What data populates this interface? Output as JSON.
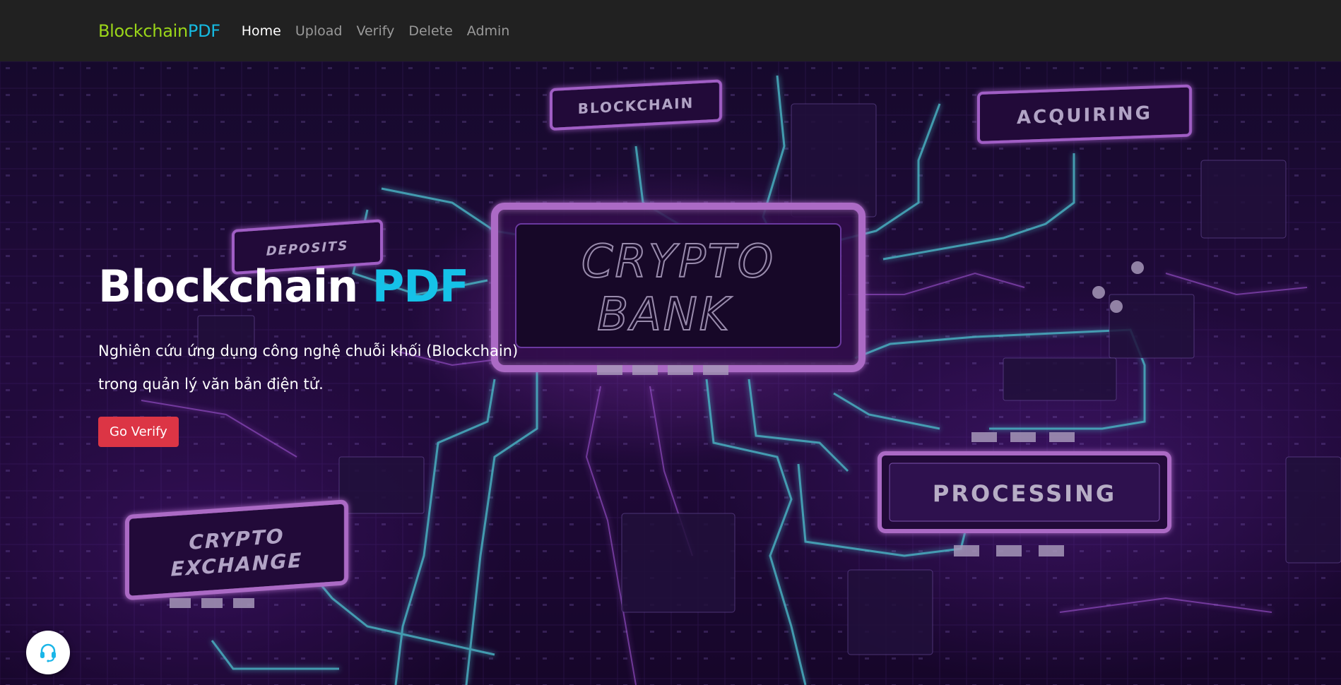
{
  "navbar": {
    "brand_part1": "Blockchain",
    "brand_part2": "PDF",
    "links": [
      {
        "label": "Home",
        "active": true
      },
      {
        "label": "Upload",
        "active": false
      },
      {
        "label": "Verify",
        "active": false
      },
      {
        "label": "Delete",
        "active": false
      },
      {
        "label": "Admin",
        "active": false
      }
    ]
  },
  "hero": {
    "title_part1": "Blockchain ",
    "title_part2": "PDF",
    "description_line1": "Nghiên cứu ứng dụng công nghệ chuỗi khối (Blockchain)",
    "description_line2": "trong quản lý văn bản điện tử.",
    "button_label": "Go Verify",
    "background_labels": {
      "blockchain": "BLOCKCHAIN",
      "acquiring": "ACQUIRING",
      "deposits": "DEPOSITS",
      "crypto_bank_line1": "CRYPTO",
      "crypto_bank_line2": "BANK",
      "processing": "PROCESSING",
      "crypto_exchange_line1": "CRYPTO",
      "crypto_exchange_line2": "EXCHANGE"
    }
  },
  "support": {
    "icon": "headset-icon"
  },
  "colors": {
    "navbar_bg": "#212121",
    "brand_green": "#9bd619",
    "brand_blue": "#15b9e0",
    "accent_cyan": "#15c2e8",
    "button_red": "#dc3545",
    "neon_purple": "#c266ff",
    "neon_cyan": "#5ff0ff"
  }
}
